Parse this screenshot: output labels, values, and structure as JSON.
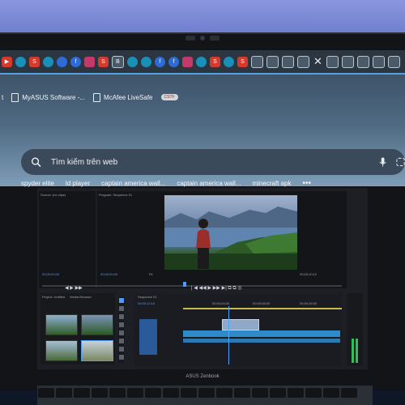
{
  "colors": {
    "accent_blue": "#4c9bff",
    "wall": "#7f8cd8",
    "tab_strip": "#2c3640"
  },
  "tab_strip": {
    "tabs": [
      {
        "icon": "youtube-icon",
        "style": "t-red",
        "glyph": "▶"
      },
      {
        "icon": "globe-icon",
        "style": "t-teal",
        "glyph": ""
      },
      {
        "icon": "s-app-icon",
        "style": "t-red",
        "glyph": "S"
      },
      {
        "icon": "edge-icon",
        "style": "t-teal",
        "glyph": ""
      },
      {
        "icon": "messenger-icon",
        "style": "t-blue",
        "glyph": ""
      },
      {
        "icon": "facebook-icon",
        "style": "t-blue",
        "glyph": "f"
      },
      {
        "icon": "mail-icon",
        "style": "t-pink",
        "glyph": ""
      },
      {
        "icon": "s-app-icon",
        "style": "t-red",
        "glyph": "S"
      },
      {
        "icon": "b-icon",
        "style": "t-grey",
        "glyph": "B"
      },
      {
        "icon": "edge-icon",
        "style": "t-teal",
        "glyph": ""
      },
      {
        "icon": "edge-icon",
        "style": "t-teal",
        "glyph": ""
      },
      {
        "icon": "facebook-icon",
        "style": "t-blue",
        "glyph": "f"
      },
      {
        "icon": "facebook-icon",
        "style": "t-blue",
        "glyph": "f"
      },
      {
        "icon": "mail-icon",
        "style": "t-pink",
        "glyph": ""
      },
      {
        "icon": "globe-icon",
        "style": "t-teal",
        "glyph": ""
      },
      {
        "icon": "s-app-icon",
        "style": "t-red",
        "glyph": "S"
      },
      {
        "icon": "edge-icon",
        "style": "t-teal",
        "glyph": ""
      },
      {
        "icon": "s-app-icon",
        "style": "t-red",
        "glyph": "S"
      },
      {
        "icon": "page-icon",
        "style": "t-grey",
        "glyph": ""
      },
      {
        "icon": "page-icon",
        "style": "t-grey",
        "glyph": ""
      },
      {
        "icon": "page-icon",
        "style": "t-grey",
        "glyph": ""
      },
      {
        "icon": "page-icon",
        "style": "t-grey",
        "glyph": ""
      },
      {
        "icon": "close-icon",
        "style": "t-close",
        "glyph": "✕"
      },
      {
        "icon": "page-icon",
        "style": "t-grey",
        "glyph": ""
      },
      {
        "icon": "page-icon",
        "style": "t-grey",
        "glyph": ""
      },
      {
        "icon": "page-icon",
        "style": "t-grey",
        "glyph": ""
      },
      {
        "icon": "page-icon",
        "style": "t-grey",
        "glyph": ""
      },
      {
        "icon": "page-icon",
        "style": "t-grey",
        "glyph": ""
      }
    ]
  },
  "bookmarks": [
    {
      "label": "t",
      "icon": "doc-icon"
    },
    {
      "label": "MyASUS Software -...",
      "icon": "doc-icon"
    },
    {
      "label": "McAfee LiveSafe",
      "icon": "doc-icon"
    }
  ],
  "bookmark_pill": "CSTF",
  "search": {
    "placeholder": "Tìm kiếm trên web"
  },
  "suggestions": [
    "spyder elite",
    "ld player",
    "captain america wall...",
    "captain america wall...",
    "minecraft apk"
  ],
  "premiere": {
    "source_tab": "Source: (no clips)",
    "program_tab": "Program: Sequence 01",
    "program_timecode_left": "00;00;00;00",
    "fit_label": "Fit",
    "program_timecode_right": "00;00;10;12",
    "source_timecode": "00;00;00;00",
    "project_tab": "Project: Untitled",
    "media_browser_tab": "Media Browser",
    "timeline_tab": "Sequence 01",
    "timeline_timecode": "00;00;12;16",
    "ruler_marks": [
      "00;00;04;00",
      "00;00;08;00",
      "00;00;16;00"
    ]
  },
  "laptop_brand": "ASUS Zenbook"
}
